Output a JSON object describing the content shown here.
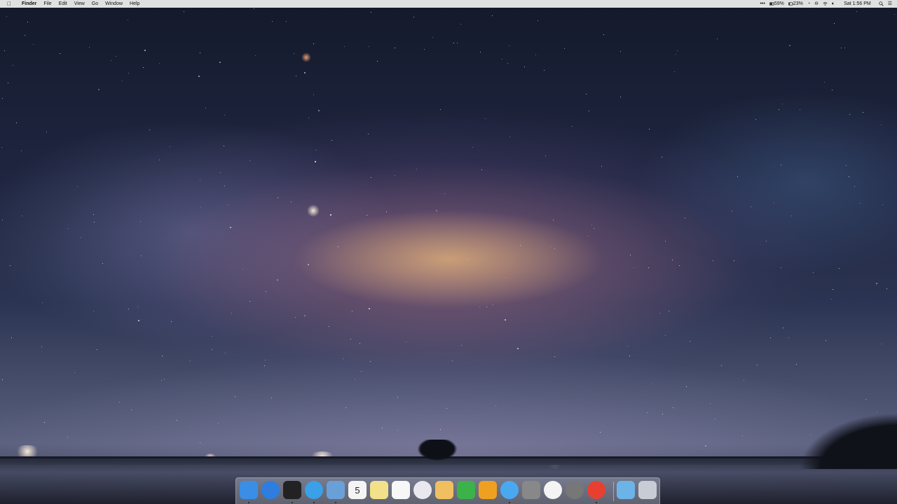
{
  "menubar": {
    "apple": "",
    "app_name": "Finder",
    "menus": [
      "File",
      "Edit",
      "View",
      "Go",
      "Window",
      "Help"
    ],
    "status": {
      "battery_left": "59%",
      "battery_right": "23%",
      "datetime": "Sat 1:56 PM"
    }
  },
  "dock": {
    "items": [
      {
        "name": "finder-icon",
        "color": "#3a8ee6"
      },
      {
        "name": "app-store-icon",
        "color": "#2d7ee0"
      },
      {
        "name": "activity-monitor-icon",
        "color": "#222"
      },
      {
        "name": "safari-icon",
        "color": "#3aa0e8"
      },
      {
        "name": "preview-icon",
        "color": "#6aa0d8"
      },
      {
        "name": "calendar-icon",
        "color": "#f4f4f4",
        "text": "5"
      },
      {
        "name": "notes-icon",
        "color": "#f3e08a"
      },
      {
        "name": "reminders-icon",
        "color": "#f7f7f7"
      },
      {
        "name": "itunes-icon",
        "color": "#e8e8ee"
      },
      {
        "name": "pages-icon",
        "color": "#f0c060"
      },
      {
        "name": "numbers-icon",
        "color": "#3bb34a"
      },
      {
        "name": "tes-icon",
        "color": "#f0a020"
      },
      {
        "name": "messages-icon",
        "color": "#4aa8f0"
      },
      {
        "name": "archive-utility-icon",
        "color": "#888"
      },
      {
        "name": "photos-icon",
        "color": "#f4f4f4"
      },
      {
        "name": "system-preferences-icon",
        "color": "#777"
      },
      {
        "name": "chrome-icon",
        "color": "#e84030"
      },
      {
        "name": "downloads-folder-icon",
        "color": "#6cb4e8"
      },
      {
        "name": "trash-icon",
        "color": "#c8ccd4"
      }
    ]
  }
}
